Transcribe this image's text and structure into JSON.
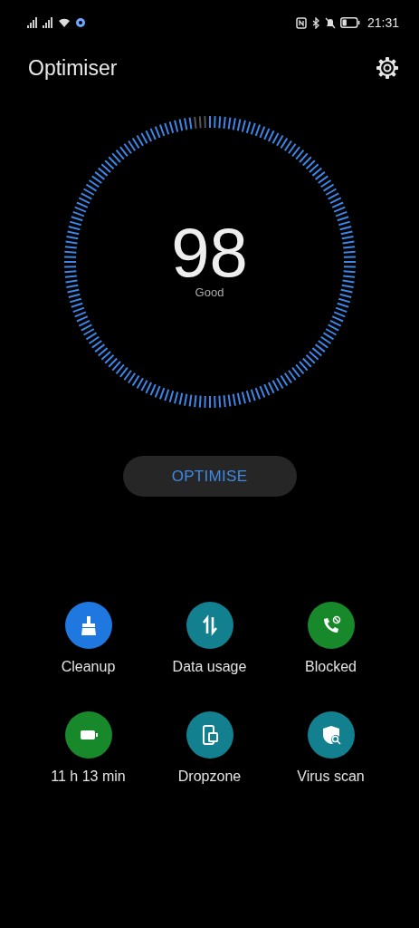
{
  "status_bar": {
    "time": "21:31"
  },
  "header": {
    "title": "Optimiser"
  },
  "score": {
    "value": "98",
    "label": "Good"
  },
  "optimise_button": {
    "label": "OPTIMISE"
  },
  "tools": [
    {
      "label": "Cleanup",
      "kind": "broom",
      "color": "#1e78e0"
    },
    {
      "label": "Data usage",
      "kind": "arrows",
      "color": "#12808f"
    },
    {
      "label": "Blocked",
      "kind": "phone",
      "color": "#18892a"
    },
    {
      "label": "11 h 13 min",
      "kind": "battery",
      "color": "#18892a"
    },
    {
      "label": "Dropzone",
      "kind": "devices",
      "color": "#12808f"
    },
    {
      "label": "Virus scan",
      "kind": "shield",
      "color": "#12808f"
    }
  ]
}
